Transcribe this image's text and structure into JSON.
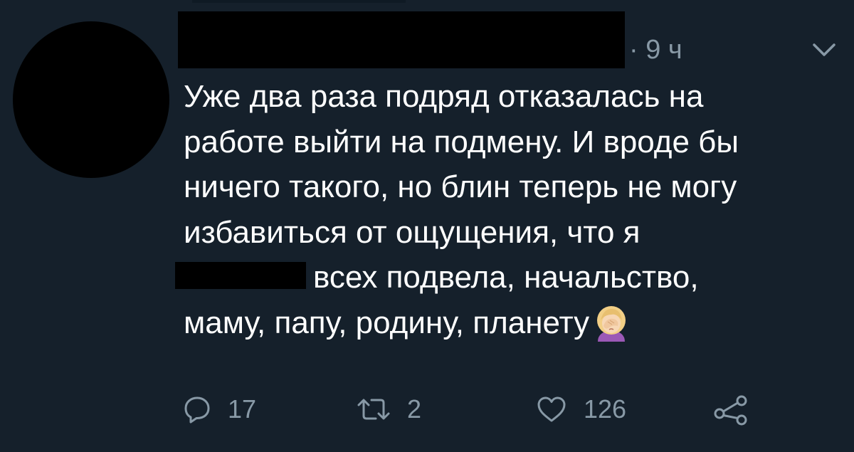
{
  "tweet": {
    "timestamp": "· 9 ч",
    "text_lines": [
      "Уже два раза подряд отказалась на",
      "работе выйти на подмену. И вроде бы",
      "ничего такого, но блин теперь не могу",
      "избавиться от ощущения, что я",
      "всех подвела, начальство,",
      "маму, папу, родину, планету"
    ],
    "emoji": "face-palm-emoji"
  },
  "actions": {
    "reply_count": "17",
    "retweet_count": "2",
    "like_count": "126"
  },
  "icons": {
    "reply": "reply-icon",
    "retweet": "retweet-icon",
    "like": "heart-icon",
    "share": "share-icon",
    "menu": "chevron-down-icon"
  },
  "colors": {
    "background": "#15202b",
    "text": "#ffffff",
    "secondary": "#8899a6"
  }
}
